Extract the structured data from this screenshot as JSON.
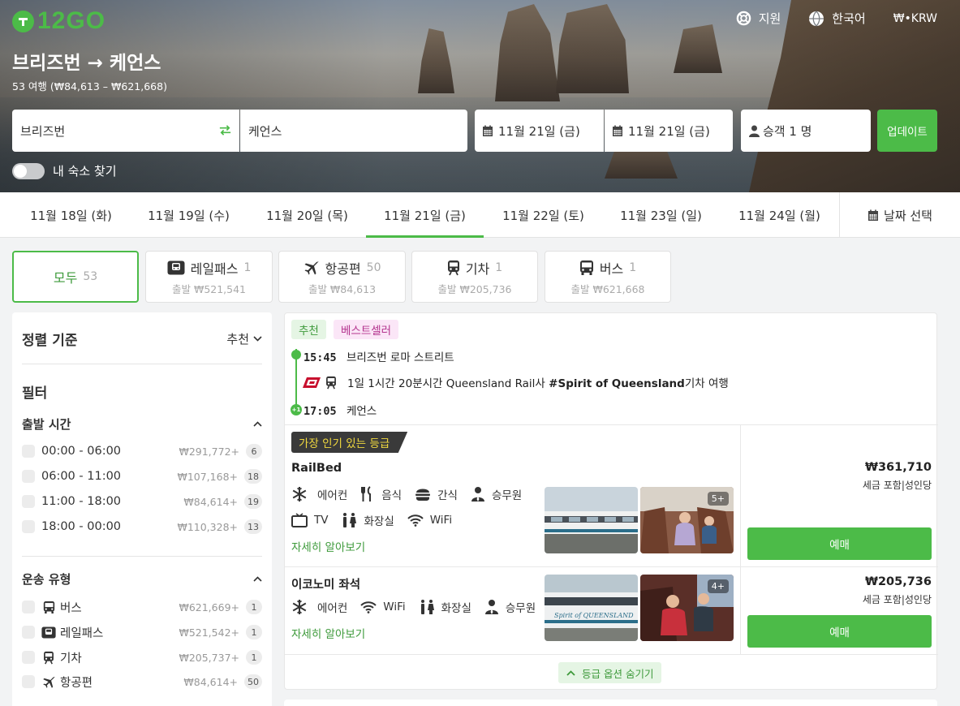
{
  "brand": {
    "logo_text": "12GO",
    "color": "#4cbb48"
  },
  "topnav": {
    "support": "지원",
    "language": "한국어",
    "currency": "₩•KRW"
  },
  "hero": {
    "title": "브리즈번 → 케언스",
    "subtitle": "53 여행 (₩84,613 – ₩621,668)"
  },
  "search": {
    "from": "브리즈번",
    "to": "케언스",
    "date_depart": "11월 21일 (금)",
    "date_return": "11월 21일 (금)",
    "passengers": "승객 1 명",
    "update_label": "업데이트",
    "accommodation_toggle": "내 숙소 찾기"
  },
  "dates": {
    "tabs": [
      "11월 18일 (화)",
      "11월 19일 (수)",
      "11월 20일 (목)",
      "11월 21일 (금)",
      "11월 22일 (토)",
      "11월 23일 (일)",
      "11월 24일 (월)"
    ],
    "active_index": 3,
    "pick_label": "날짜 선택"
  },
  "types": {
    "all": {
      "label": "모두",
      "count": "53"
    },
    "railpass": {
      "label": "레일패스",
      "count": "1",
      "from": "출발 ₩521,541",
      "icon": "railpass-icon"
    },
    "flight": {
      "label": "항공편",
      "count": "50",
      "from": "출발 ₩84,613",
      "icon": "plane-icon"
    },
    "train": {
      "label": "기차",
      "count": "1",
      "from": "출발 ₩205,736",
      "icon": "train-icon"
    },
    "bus": {
      "label": "버스",
      "count": "1",
      "from": "출발 ₩621,668",
      "icon": "bus-icon"
    }
  },
  "sidebar": {
    "sort_title": "정렬 기준",
    "sort_value": "추천",
    "filter_title": "필터",
    "departure": {
      "title": "출발 시간",
      "options": [
        {
          "label": "00:00 - 06:00",
          "price": "₩291,772+",
          "count": "6"
        },
        {
          "label": "06:00 - 11:00",
          "price": "₩107,168+",
          "count": "18"
        },
        {
          "label": "11:00 - 18:00",
          "price": "₩84,614+",
          "count": "19"
        },
        {
          "label": "18:00 - 00:00",
          "price": "₩110,328+",
          "count": "13"
        }
      ]
    },
    "transport": {
      "title": "운송 유형",
      "options": [
        {
          "label": "버스",
          "price": "₩621,669+",
          "count": "1",
          "icon": "bus-icon"
        },
        {
          "label": "레일패스",
          "price": "₩521,542+",
          "count": "1",
          "icon": "railpass-icon"
        },
        {
          "label": "기차",
          "price": "₩205,737+",
          "count": "1",
          "icon": "train-icon"
        },
        {
          "label": "항공편",
          "price": "₩84,614+",
          "count": "50",
          "icon": "plane-icon"
        }
      ]
    }
  },
  "result": {
    "tags": [
      "추천",
      "베스트셀러"
    ],
    "depart_time": "15:45",
    "depart_place": "브리즈번 로마 스트리트",
    "leg_text_pre": "1일 1시간 20분시간 Queensland Rail사 ",
    "leg_text_bold": "#Spirit of Queensland",
    "leg_text_post": "기차 여행",
    "arrive_time": "17:05",
    "arrive_place": "케언스",
    "arrive_badge": "+1",
    "classes": [
      {
        "popular_tag": "가장 인기 있는 등급",
        "name": "RailBed",
        "amenities_row1": [
          "에어컨",
          "음식",
          "간식",
          "승무원"
        ],
        "amenities_row2": [
          "TV",
          "화장실",
          "WiFi"
        ],
        "more": "자세히 알아보기",
        "photo_count": "5+",
        "price": "₩361,710",
        "price_note": "세금 포함|성인당",
        "buy": "예매"
      },
      {
        "name": "이코노미 좌석",
        "amenities_row1": [
          "에어컨",
          "WiFi",
          "화장실",
          "승무원"
        ],
        "more": "자세히 알아보기",
        "photo_count": "4+",
        "photo_caption": "Spirit of QUEENSLAND",
        "price": "₩205,736",
        "price_note": "세금 포함|성인당",
        "buy": "예매"
      }
    ],
    "hide_options": "등급 옵션 숨기기"
  }
}
